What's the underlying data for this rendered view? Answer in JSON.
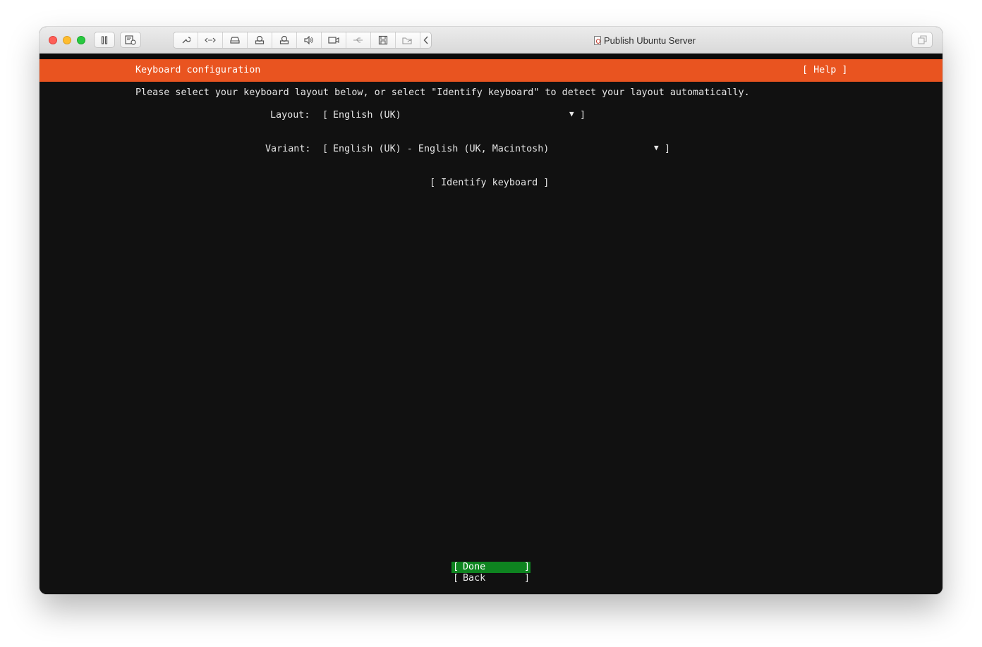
{
  "window": {
    "title": "Publish Ubuntu Server"
  },
  "installer": {
    "header_title": "Keyboard configuration",
    "help_button": "[ Help ]",
    "instructions": "Please select your keyboard layout below, or select \"Identify keyboard\" to detect your layout automatically.",
    "layout": {
      "label": "Layout:",
      "open_bracket": "[",
      "value": "English (UK)",
      "arrow": "▼",
      "close_bracket": "]"
    },
    "variant": {
      "label": "Variant:",
      "open_bracket": "[",
      "value": "English (UK) - English (UK, Macintosh)",
      "arrow": "▼",
      "close_bracket": "]"
    },
    "identify_button": "[ Identify keyboard ]",
    "done_button": {
      "open": "[",
      "label": "Done",
      "close": "]"
    },
    "back_button": {
      "open": "[",
      "label": "Back",
      "close": "]"
    }
  },
  "colors": {
    "accent_orange": "#e95420",
    "done_green": "#0e8420",
    "terminal_bg": "#111111"
  }
}
